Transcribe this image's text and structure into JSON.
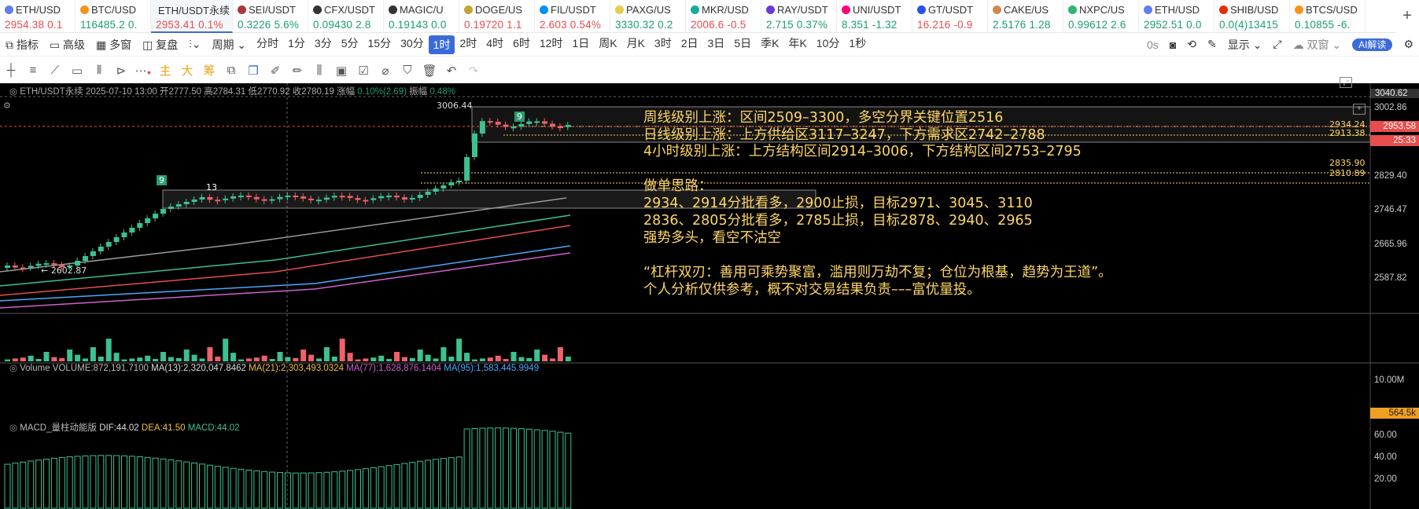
{
  "tabs": [
    {
      "sym": "ETH/USD",
      "price": "2954.38",
      "chg": "0.1",
      "dir": "dn",
      "ic": "#627eea"
    },
    {
      "sym": "BTC/USD",
      "price": "116485.2",
      "chg": "0.",
      "dir": "up",
      "ic": "#f7931a"
    },
    {
      "sym": "ETH/USDT永续",
      "price": "2953.41",
      "chg": "0.1%",
      "dir": "dn",
      "ic": "#555",
      "active": true
    },
    {
      "sym": "SEI/USDT",
      "price": "0.3226",
      "chg": "5.6%",
      "dir": "up",
      "ic": "#b0343c"
    },
    {
      "sym": "CFX/USDT",
      "price": "0.09430",
      "chg": "2.8",
      "dir": "up",
      "ic": "#333"
    },
    {
      "sym": "MAGIC/U",
      "price": "0.19143",
      "chg": "0.0",
      "dir": "up",
      "ic": "#333"
    },
    {
      "sym": "DOGE/US",
      "price": "0.19720",
      "chg": "1.1",
      "dir": "dn",
      "ic": "#c2a633"
    },
    {
      "sym": "FIL/USDT",
      "price": "2.603",
      "chg": "0.54%",
      "dir": "dn",
      "ic": "#0090ff"
    },
    {
      "sym": "PAXG/US",
      "price": "3330.32",
      "chg": "0.2",
      "dir": "up",
      "ic": "#e4ce4d"
    },
    {
      "sym": "MKR/USD",
      "price": "2006.6",
      "chg": "-0.5",
      "dir": "dn",
      "ic": "#1aab9b"
    },
    {
      "sym": "RAY/USDT",
      "price": "2.715",
      "chg": "0.37%",
      "dir": "up",
      "ic": "#6c3bd9"
    },
    {
      "sym": "UNI/USDT",
      "price": "8.351",
      "chg": "-1.32",
      "dir": "up",
      "ic": "#ff007a"
    },
    {
      "sym": "GT/USDT",
      "price": "16.216",
      "chg": "-0.9",
      "dir": "dn",
      "ic": "#2354e6"
    },
    {
      "sym": "CAKE/US",
      "price": "2.5176",
      "chg": "1.28",
      "dir": "up",
      "ic": "#d1884f"
    },
    {
      "sym": "NXPC/US",
      "price": "0.99612",
      "chg": "2.6",
      "dir": "up",
      "ic": "#2bb673"
    },
    {
      "sym": "ETH/USD",
      "price": "2952.51",
      "chg": "0.0",
      "dir": "up",
      "ic": "#627eea"
    },
    {
      "sym": "SHIB/USD",
      "price": "0.0(4)13415",
      "chg": "",
      "dir": "up",
      "ic": "#e42d04"
    },
    {
      "sym": "BTCS/USD",
      "price": "0.10855",
      "chg": "-6.",
      "dir": "up",
      "ic": "#f7931a"
    }
  ],
  "toolbar": {
    "left": [
      "指标",
      "高级",
      "多窗",
      "复盘"
    ],
    "period": "周期",
    "intervals": [
      "分时",
      "1分",
      "3分",
      "5分",
      "15分",
      "30分",
      "1时",
      "2时",
      "4时",
      "6时",
      "12时",
      "1日",
      "周K",
      "月K",
      "3时",
      "2日",
      "3日",
      "5日",
      "季K",
      "年K",
      "10分",
      "1秒"
    ],
    "selected": "1时",
    "timer": "0s",
    "display": "显示",
    "double": "双窗",
    "ai": "AI解读"
  },
  "draw_tools": [
    "主",
    "大",
    "筹"
  ],
  "info": {
    "symbol": "ETH/USDT永续",
    "time": "2025-07-10 13:00",
    "open_label": "开",
    "open": "2777.50",
    "high_label": "高",
    "high": "2784.31",
    "low_label": "低",
    "low": "2770.92",
    "close_label": "收",
    "close": "2780.19",
    "chg_label": "涨幅",
    "chg": "0.10%(2.69)",
    "amp_label": "振幅",
    "amp": "0.48%"
  },
  "analysis": {
    "line1": "周线级别上涨：区间2509–3300，多空分界关键位置2516",
    "line2": "日线级别上涨：上方供给区3117–3247，下方需求区2742–2788",
    "line3": "4小时级别上涨：上方结构区间2914–3006，下方结构区间2753–2795",
    "line4": "做单思路：",
    "line5": "2934、2914分批看多，2900止损，目标2971、3045、3110",
    "line6": "2836、2805分批看多，2785止损，目标2878、2940、2965",
    "line7": "强势多头，看空不沽空",
    "line8": "“杠杆双刃：善用可乘势聚富，滥用则万劫不复；仓位为根基，趋势为王道”。",
    "line9": "个人分析仅供参考，概不对交易结果负责–––富优量投。"
  },
  "price_axis": [
    "3040.62",
    "3002.86",
    "2829.40",
    "2746.47",
    "2665.96",
    "2587.82"
  ],
  "levels": {
    "l1": "2934.24",
    "l2": "2913.38",
    "l3": "2835.90",
    "l4": "2810.89"
  },
  "price_tag": "2953.58",
  "countdown": "25:33",
  "marks": {
    "high": "3006.44",
    "low": "← 2602.87",
    "n1": "9",
    "n2": "13",
    "n3": "9"
  },
  "volume": {
    "label": "Volume",
    "vol": "VOLUME:872,191.7100",
    "ma13": "MA(13):2,320,047.8462",
    "ma21": "MA(21):2,303,493.0324",
    "ma77": "MA(77):1,628,876.1404",
    "ma95": "MA(95):1,583,445.9949",
    "axis": "10.00M",
    "tag": "564.5k"
  },
  "macd": {
    "label": "MACD_量柱动能版",
    "dif": "DIF:44.02",
    "dea": "DEA:41.50",
    "macd": "MACD:44.02",
    "axis": [
      "60.00",
      "40.00",
      "20.00"
    ]
  },
  "colors": {
    "up": "#1a9e6e",
    "down": "#e84d4d",
    "candle_up": "#3cc18f",
    "candle_down": "#f0616a",
    "text": "#ffd666"
  }
}
